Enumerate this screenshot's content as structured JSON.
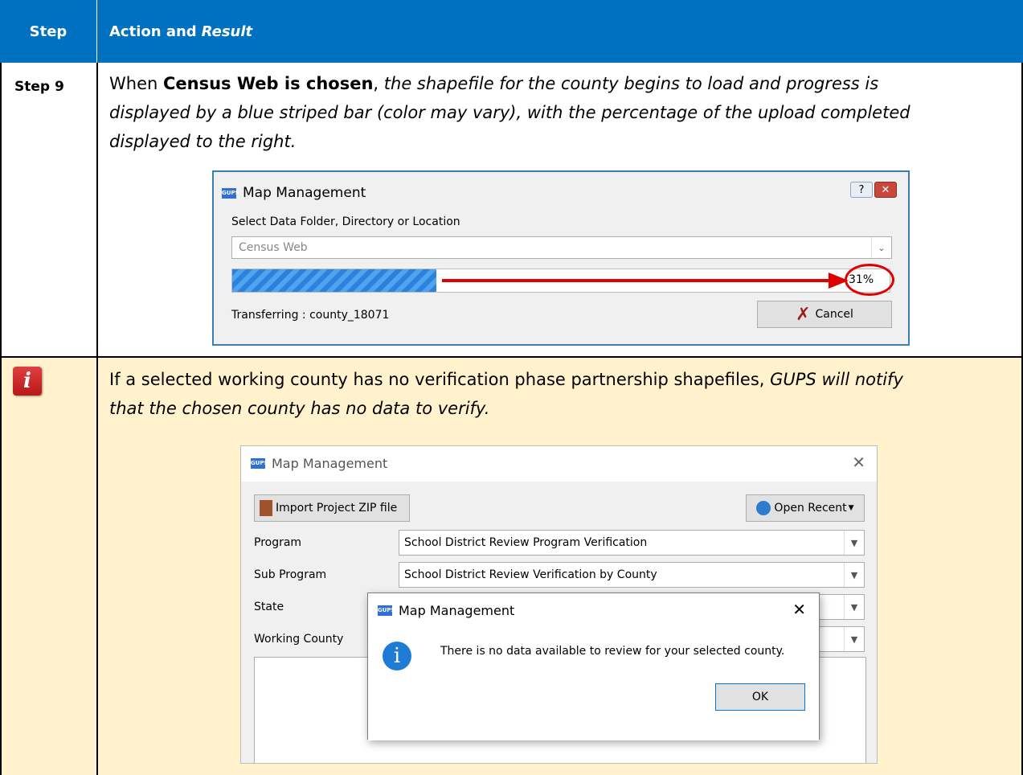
{
  "header": {
    "step": "Step",
    "action": "Action and",
    "result": "Result"
  },
  "step9": {
    "label": "Step 9",
    "text_a": "When",
    "text_bold": "Census Web is chosen",
    "text_b": ",",
    "text_italic_1": "the shapefile for the county begins to load and progress is",
    "text_italic_2": "displayed by a blue striped bar (color may vary), with the percentage of the upload completed",
    "text_italic_3": "displayed to the right."
  },
  "dialog1": {
    "title": "Map Management",
    "help": "?",
    "close": "✕",
    "select_label": "Select Data Folder, Directory or Location",
    "location": "Census Web",
    "progress_pct": 31,
    "progress_text": "31%",
    "status": "Transferring : county_18071",
    "cancel": "Cancel"
  },
  "note": {
    "text_a": "If a selected working county has no verification phase partnership shapefiles,",
    "text_italic_a": "GUPS will notify",
    "text_italic_b": "that the chosen county has no data to verify."
  },
  "dialog2": {
    "title": "Map Management",
    "close": "✕",
    "import_btn": "Import Project ZIP file",
    "open_recent": "Open Recent",
    "program_label": "Program",
    "program_value": "School District Review Program Verification",
    "subprogram_label": "Sub Program",
    "subprogram_value": "School District Review Verification by County",
    "state_label": "State",
    "county_label": "Working County"
  },
  "dialog3": {
    "title": "Map Management",
    "close": "✕",
    "message": "There is no data available to review for your selected county.",
    "ok": "OK"
  },
  "colors": {
    "header_bg": "#0070c0",
    "note_bg": "#fff2cc",
    "progress": "#2a82dd",
    "callout_red": "#e00000"
  }
}
